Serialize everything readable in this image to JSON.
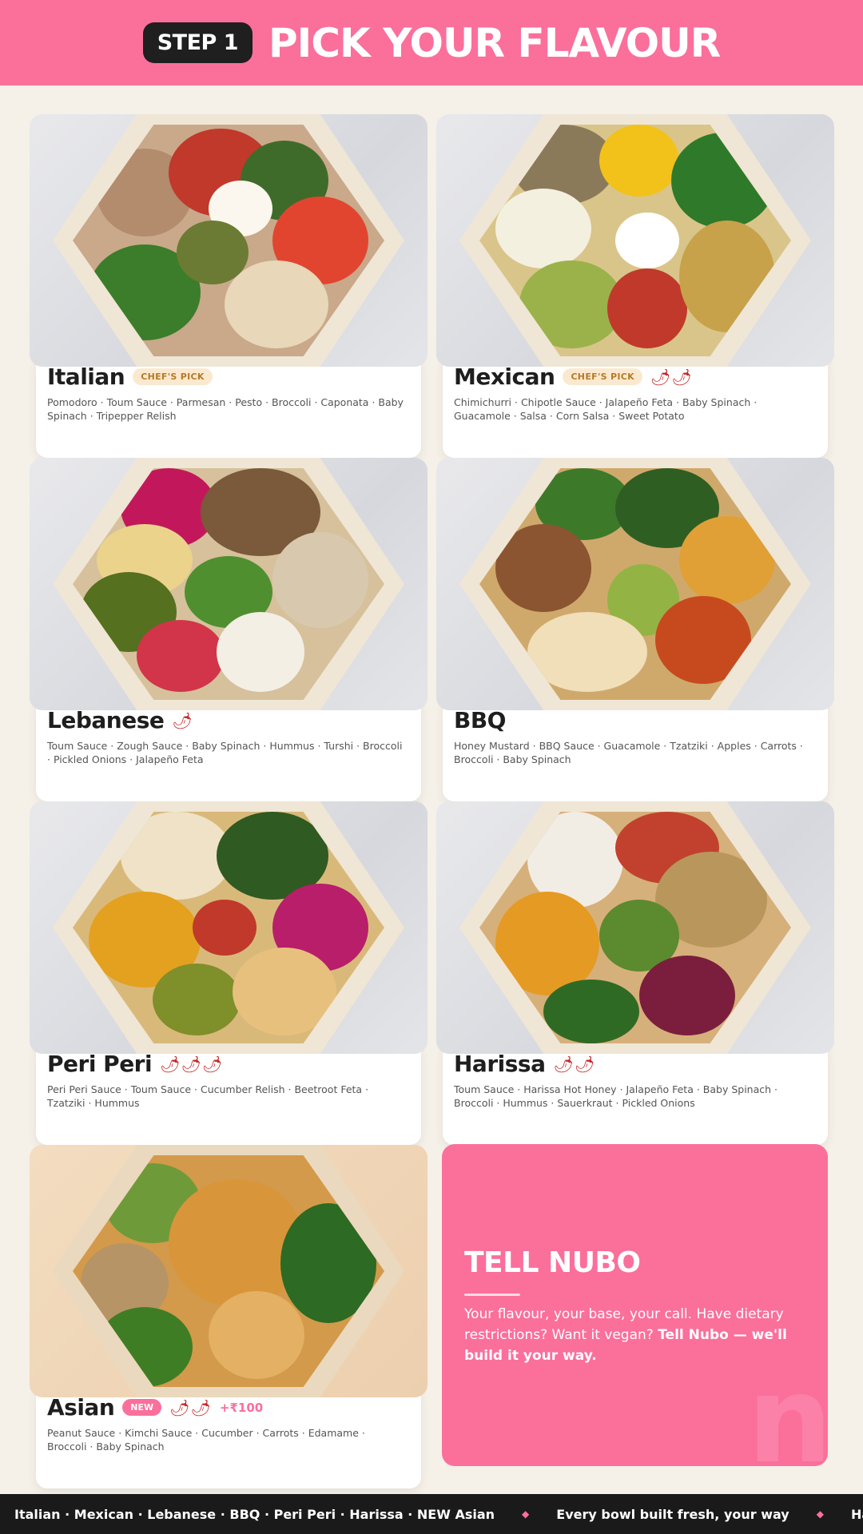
{
  "header": {
    "step_label": "STEP 1",
    "title": "PICK YOUR FLAVOUR",
    "background_color": "#fb6f9b"
  },
  "flavours": [
    {
      "name": "Italian",
      "badge": "CHEF'S PICK",
      "chili_level": 0,
      "ingredients": "Pomodoro · Toum Sauce · Parmesan · Pesto · Broccoli · Caponata · Baby Spinach · Tripepper Relish"
    },
    {
      "name": "Mexican",
      "badge": "CHEF'S PICK",
      "chili_level": 2,
      "ingredients": "Chimichurri · Chipotle Sauce · Jalapeño Feta · Baby Spinach · Guacamole · Salsa · Corn Salsa · Sweet Potato"
    },
    {
      "name": "Lebanese",
      "chili_level": 1,
      "ingredients": "Toum Sauce · Zough Sauce · Baby Spinach · Hummus · Turshi · Broccoli · Pickled Onions · Jalapeño Feta"
    },
    {
      "name": "BBQ",
      "chili_level": 0,
      "ingredients": "Honey Mustard · BBQ Sauce · Guacamole · Tzatziki · Apples · Carrots · Broccoli · Baby Spinach"
    },
    {
      "name": "Peri Peri",
      "chili_level": 3,
      "ingredients": "Peri Peri Sauce · Toum Sauce · Cucumber Relish · Beetroot Feta · Tzatziki · Hummus"
    },
    {
      "name": "Harissa",
      "chili_level": 2,
      "ingredients": "Toum Sauce · Harissa Hot Honey · Jalapeño Feta · Baby Spinach · Broccoli · Hummus · Sauerkraut · Pickled Onions"
    },
    {
      "name": "Asian",
      "badge": "NEW",
      "chili_level": 2,
      "price_note": "+₹100",
      "ingredients": "Peanut Sauce · Kimchi Sauce · Cucumber · Carrots · Edamame · Broccoli · Baby Spinach"
    }
  ],
  "chili_icon": "🌶",
  "promo": {
    "title": "TELL NUBO",
    "body_text": "Your flavour, your base, your call. Have dietary restrictions? Want it vegan? ",
    "body_bold": "Tell Nubo — we'll build it your way.",
    "watermark": "n"
  },
  "ticker": {
    "items": [
      "Italian · Mexican · Lebanese · BBQ · Peri Peri · Harissa · NEW Asian",
      "Every bowl built fresh, your way",
      "Have a dietary"
    ],
    "separator_icon": "◆"
  }
}
